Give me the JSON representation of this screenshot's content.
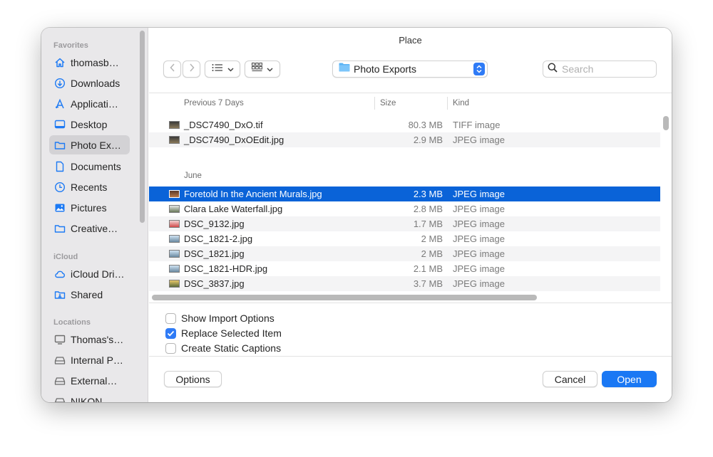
{
  "dialog": {
    "title": "Place"
  },
  "sidebar": {
    "sections": [
      {
        "title": "Favorites",
        "items": [
          {
            "label": "thomasb…",
            "icon": "home-icon"
          },
          {
            "label": "Downloads",
            "icon": "download-icon"
          },
          {
            "label": "Applicati…",
            "icon": "applications-icon"
          },
          {
            "label": "Desktop",
            "icon": "desktop-icon"
          },
          {
            "label": "Photo Ex…",
            "icon": "folder-icon",
            "active": true
          },
          {
            "label": "Documents",
            "icon": "document-icon"
          },
          {
            "label": "Recents",
            "icon": "clock-icon"
          },
          {
            "label": "Pictures",
            "icon": "pictures-icon"
          },
          {
            "label": "Creative…",
            "icon": "folder-icon"
          }
        ]
      },
      {
        "title": "iCloud",
        "items": [
          {
            "label": "iCloud Dri…",
            "icon": "cloud-icon"
          },
          {
            "label": "Shared",
            "icon": "shared-folder-icon"
          }
        ]
      },
      {
        "title": "Locations",
        "items": [
          {
            "label": "Thomas's…",
            "icon": "computer-icon"
          },
          {
            "label": "Internal P…",
            "icon": "drive-icon"
          },
          {
            "label": "External…",
            "icon": "drive-icon"
          },
          {
            "label": "NIKON…",
            "icon": "drive-icon"
          }
        ]
      }
    ]
  },
  "toolbar": {
    "back_icon": "chevron-left-icon",
    "forward_icon": "chevron-right-icon",
    "list_view_icon": "list-view-icon",
    "grid_view_icon": "grid-view-icon",
    "current_folder": "Photo Exports",
    "search_placeholder": "Search"
  },
  "columns": {
    "name": "Previous 7 Days",
    "size": "Size",
    "kind": "Kind"
  },
  "groups": [
    {
      "label": "",
      "files": [
        {
          "name": "_DSC7490_DxO.tif",
          "size": "80.3 MB",
          "kind": "TIFF image"
        },
        {
          "name": "_DSC7490_DxOEdit.jpg",
          "size": "2.9 MB",
          "kind": "JPEG image"
        }
      ]
    },
    {
      "label": "June",
      "files": [
        {
          "name": "Foretold In the Ancient Murals.jpg",
          "size": "2.3 MB",
          "kind": "JPEG image",
          "selected": true
        },
        {
          "name": "Clara Lake Waterfall.jpg",
          "size": "2.8 MB",
          "kind": "JPEG image"
        },
        {
          "name": "DSC_9132.jpg",
          "size": "1.7 MB",
          "kind": "JPEG image"
        },
        {
          "name": "DSC_1821-2.jpg",
          "size": "2 MB",
          "kind": "JPEG image"
        },
        {
          "name": "DSC_1821.jpg",
          "size": "2 MB",
          "kind": "JPEG image"
        },
        {
          "name": "DSC_1821-HDR.jpg",
          "size": "2.1 MB",
          "kind": "JPEG image"
        },
        {
          "name": "DSC_3837.jpg",
          "size": "3.7 MB",
          "kind": "JPEG image"
        }
      ]
    }
  ],
  "options": [
    {
      "label": "Show Import Options",
      "checked": false
    },
    {
      "label": "Replace Selected Item",
      "checked": true
    },
    {
      "label": "Create Static Captions",
      "checked": false
    }
  ],
  "buttons": {
    "options": "Options",
    "cancel": "Cancel",
    "open": "Open"
  },
  "colors": {
    "accent": "#1a78f4",
    "selection": "#0a63d8",
    "sidebar": "#e9e8ea"
  }
}
